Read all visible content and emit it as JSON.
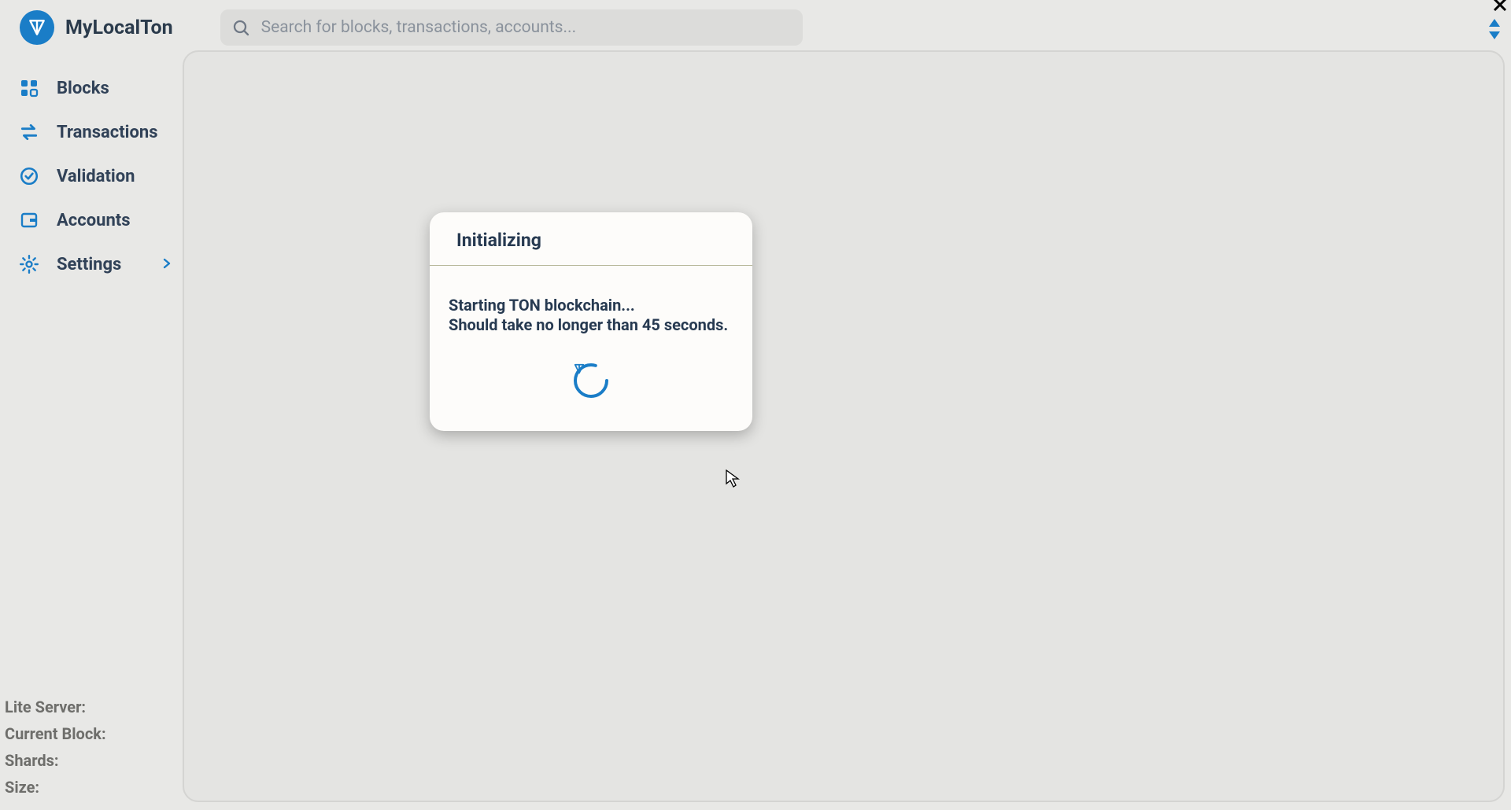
{
  "app": {
    "title": "MyLocalTon"
  },
  "search": {
    "placeholder": "Search for blocks, transactions, accounts..."
  },
  "sidebar": {
    "items": [
      {
        "label": "Blocks",
        "icon": "blocks-icon"
      },
      {
        "label": "Transactions",
        "icon": "transactions-icon"
      },
      {
        "label": "Validation",
        "icon": "validation-icon"
      },
      {
        "label": "Accounts",
        "icon": "accounts-icon"
      },
      {
        "label": "Settings",
        "icon": "settings-icon",
        "chevron": true
      }
    ]
  },
  "status": {
    "lite_server_label": "Lite Server:",
    "current_block_label": "Current Block:",
    "shards_label": "Shards:",
    "size_label": "Size:"
  },
  "dialog": {
    "title": "Initializing",
    "line1": "Starting TON blockchain...",
    "line2": "Should take no longer than 45 seconds."
  },
  "colors": {
    "accent": "#1a7dc7"
  }
}
